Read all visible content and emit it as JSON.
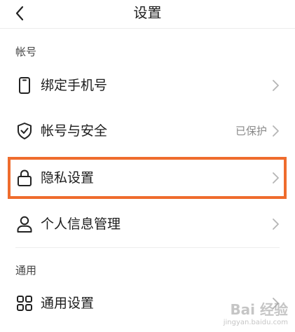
{
  "header": {
    "title": "设置",
    "back_icon": "back-arrow-icon"
  },
  "sections": [
    {
      "title": "帐号",
      "items": [
        {
          "label": "绑定手机号",
          "value": "",
          "icon": "phone-icon"
        },
        {
          "label": "帐号与安全",
          "value": "已保护",
          "icon": "shield-check-icon"
        },
        {
          "label": "隐私设置",
          "value": "",
          "icon": "lock-icon"
        },
        {
          "label": "个人信息管理",
          "value": "",
          "icon": "person-icon"
        }
      ]
    },
    {
      "title": "通用",
      "items": [
        {
          "label": "通用设置",
          "value": "",
          "icon": "grid-icon"
        }
      ]
    }
  ],
  "highlight_color": "#ef6c2d",
  "watermark": {
    "text": "Bai 经验",
    "sub": "jingyan.baidu.com"
  }
}
